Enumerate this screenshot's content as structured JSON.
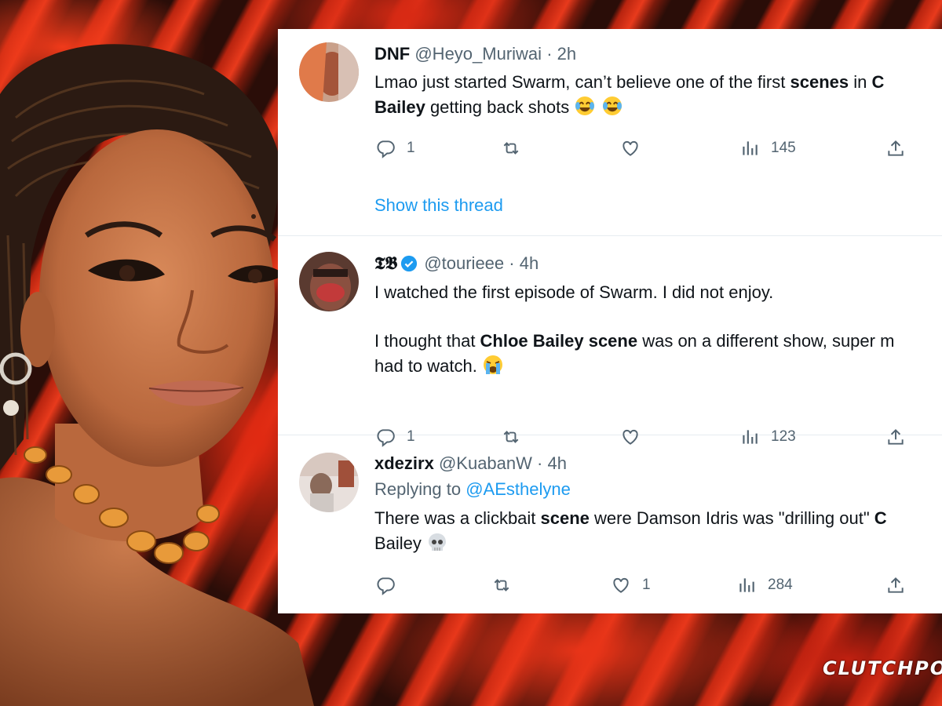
{
  "watermark": "CLUTCHPO",
  "tweets": [
    {
      "display_name": "DNF",
      "handle": "@Heyo_Muriwai",
      "sep": "·",
      "time": "2h",
      "verified": false,
      "line1": [
        "Lmao just started Swarm, can’t believe one of the first ",
        "scenes",
        " in ",
        "C"
      ],
      "line2": [
        "Bailey",
        " getting back shots "
      ],
      "emoji": [
        "joy-emoji",
        "joy-emoji"
      ],
      "replies": "1",
      "retweets": "",
      "likes": "",
      "views": "145",
      "show_thread": "Show this thread"
    },
    {
      "display_name": "𝕿𝕭",
      "handle": "@tourieee",
      "sep": "·",
      "time": "4h",
      "verified": true,
      "line1": "I watched the first episode of Swarm. I did not enjoy.",
      "line2": [
        "I thought that ",
        "Chloe Bailey scene",
        " was on a different show, super m"
      ],
      "line3": "had to watch. ",
      "emoji": [
        "loudly-crying-emoji"
      ],
      "replies": "1",
      "retweets": "",
      "likes": "",
      "views": "123"
    },
    {
      "display_name": "xdezirx",
      "handle": "@KuabanW",
      "sep": "·",
      "time": "4h",
      "verified": false,
      "replying_prefix": "Replying to ",
      "replying_handle": "@AEsthelyne",
      "line1": [
        "There was a clickbait ",
        "scene",
        " were Damson Idris was \"drilling out\" ",
        "C"
      ],
      "line2": "Bailey ",
      "emoji": [
        "skull-emoji"
      ],
      "replies": "",
      "retweets": "",
      "likes": "1",
      "views": "284"
    }
  ],
  "colors": {
    "link": "#1d9bf0",
    "muted": "#536471",
    "text": "#0f1419",
    "verified": "#1d9bf0",
    "background_red": "#e83a1c"
  }
}
